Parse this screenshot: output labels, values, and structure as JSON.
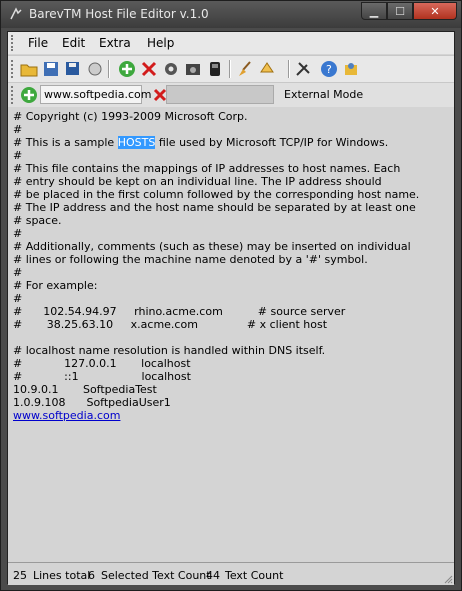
{
  "window": {
    "title": "BarevTM Host File Editor v.1.0"
  },
  "menu": [
    "File",
    "Edit",
    "Extra",
    "Help"
  ],
  "toolbar_icons": [
    "open-folder-icon",
    "save-icon",
    "save-as-icon",
    "mirror-icon",
    "add-icon",
    "delete-icon",
    "settings-icon",
    "backup-icon",
    "notepad-icon",
    "broom-icon",
    "bookmark-icon",
    "tools-icon",
    "help-icon",
    "about-icon"
  ],
  "address": {
    "value": "www.softpedia.com",
    "mode": "External Mode"
  },
  "editor": {
    "lines": [
      "# Copyright (c) 1993-2009 Microsoft Corp.",
      "#",
      "",
      "#",
      "# This file contains the mappings of IP addresses to host names. Each",
      "# entry should be kept on an individual line. The IP address should",
      "# be placed in the first column followed by the corresponding host name.",
      "# The IP address and the host name should be separated by at least one",
      "# space.",
      "#",
      "# Additionally, comments (such as these) may be inserted on individual",
      "# lines or following the machine name denoted by a '#' symbol.",
      "#",
      "# For example:",
      "#",
      "#      102.54.94.97     rhino.acme.com          # source server",
      "#       38.25.63.10     x.acme.com              # x client host",
      "",
      "# localhost name resolution is handled within DNS itself.",
      "#            127.0.0.1       localhost",
      "#            ::1                  localhost",
      "10.9.0.1       SoftpediaTest",
      "1.0.9.108      SoftpediaUser1"
    ],
    "sample_line": {
      "before": "# This is a sample ",
      "highlight": "HOSTS",
      "after": " file used by Microsoft TCP/IP for Windows."
    },
    "link": "www.softpedia.com"
  },
  "status": {
    "lines_total": "25",
    "lines_label": "Lines total",
    "selected_count": "6",
    "selected_label": "Selected Text Count",
    "text_count": "44",
    "text_label": "Text Count"
  }
}
